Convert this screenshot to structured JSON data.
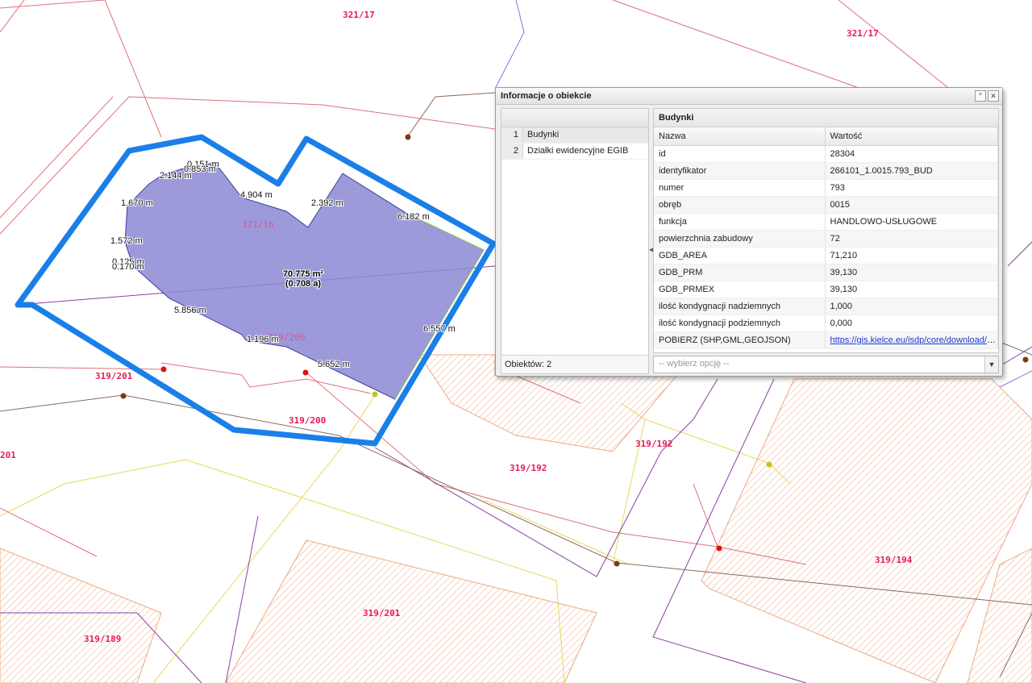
{
  "map": {
    "parcel_labels": [
      "321/17",
      "321/17",
      "321/16",
      "319/200",
      "319/201",
      "319/200",
      "319/192",
      "319/192",
      "319/194",
      "319/201",
      "319/189",
      "201"
    ],
    "dimensions": [
      "0.151 m",
      "0.853 m",
      "2.144 m",
      "1.670 m",
      "4.904 m",
      "2.392 m",
      "6.182 m",
      "1.572 m",
      "0.125 m",
      "0.170 m",
      "5.856 m",
      "1.196 m",
      "5.652 m",
      "6.557 m"
    ],
    "area_label": {
      "line1": "70.775 m²",
      "line2": "(0.708 a)"
    },
    "colors": {
      "selection_outline": "#1a7fe8",
      "building_fill": "#8c8ad4",
      "parcel_line": "#e0707a",
      "hatch": "#f0a880",
      "label": "#e8195a"
    }
  },
  "info_window": {
    "title": "Informacje o obiekcie",
    "left_list": [
      {
        "num": "1",
        "label": "Budynki"
      },
      {
        "num": "2",
        "label": "Działki ewidencyjne EGIB"
      }
    ],
    "objects_count": "Obiektów: 2",
    "heading": "Budynki",
    "columns": [
      "Nazwa",
      "Wartość"
    ],
    "rows": [
      {
        "name": "id",
        "value": "28304"
      },
      {
        "name": "identyfikator",
        "value": "266101_1.0015.793_BUD"
      },
      {
        "name": "numer",
        "value": "793"
      },
      {
        "name": "obręb",
        "value": "0015"
      },
      {
        "name": "funkcja",
        "value": "HANDLOWO-USŁUGOWE"
      },
      {
        "name": "powierzchnia zabudowy",
        "value": "72"
      },
      {
        "name": "GDB_AREA",
        "value": "71,210"
      },
      {
        "name": "GDB_PRM",
        "value": "39,130"
      },
      {
        "name": "GDB_PRMEX",
        "value": "39,130"
      },
      {
        "name": "ilość kondygnacji nadziemnych",
        "value": "1,000"
      },
      {
        "name": "ilość kondygnacji podziemnych",
        "value": "0,000"
      },
      {
        "name": "POBIERZ (SHP,GML,GEOJSON)",
        "value": "https://gis.kielce.eu/isdp/core/download/do..."
      }
    ],
    "select_placeholder": "-- wybierz opcję --",
    "icons": {
      "collapse": "double-chevron-up-icon",
      "close": "close-icon",
      "dropdown": "chevron-down-icon"
    }
  }
}
